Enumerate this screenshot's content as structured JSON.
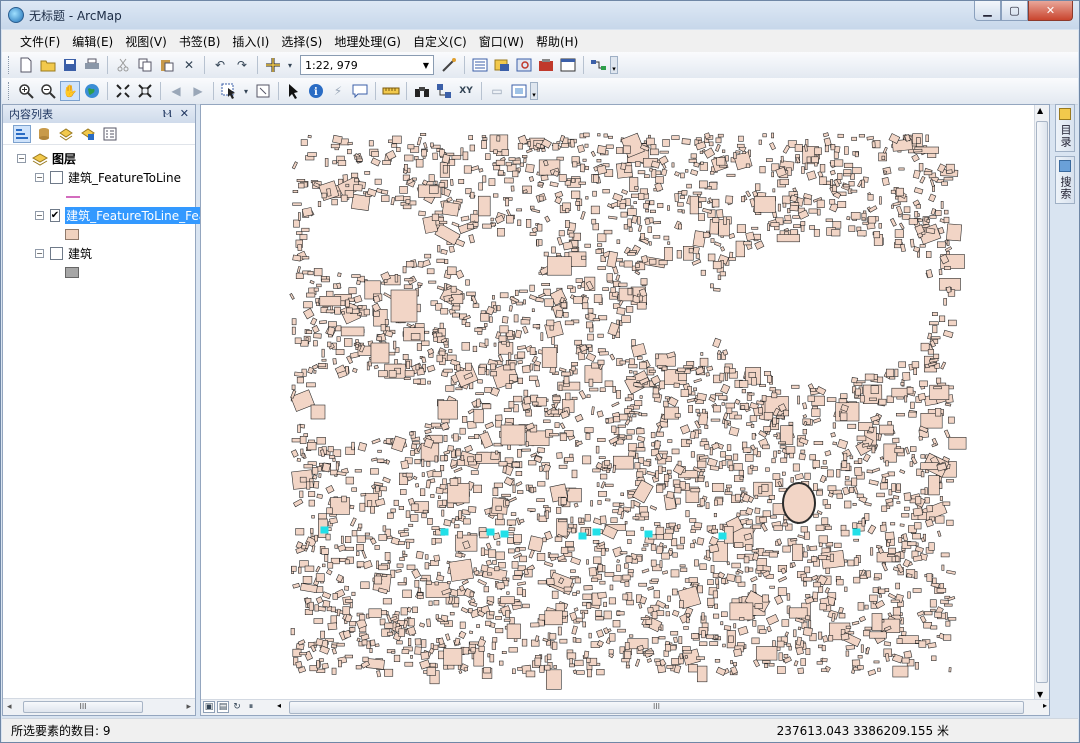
{
  "window": {
    "title": "无标题 - ArcMap",
    "buttons": {
      "minimize": "▁",
      "maximize": "▢",
      "close": "✕"
    }
  },
  "menu": [
    "文件(F)",
    "编辑(E)",
    "视图(V)",
    "书签(B)",
    "插入(I)",
    "选择(S)",
    "地理处理(G)",
    "自定义(C)",
    "窗口(W)",
    "帮助(H)"
  ],
  "toolbar": {
    "scale": "1:22, 979"
  },
  "toc": {
    "title": "内容列表",
    "pin": "Ⲙ",
    "close": "✕",
    "root_label": "图层",
    "layers": [
      {
        "label": "建筑_FeatureToLine",
        "checked": false,
        "swatch_color": "#c43aa8",
        "swatch_type": "line"
      },
      {
        "label": "建筑_FeatureToLine_Fea",
        "checked": true,
        "selected": true,
        "swatch_color": "#f0d2bf",
        "swatch_type": "fill"
      },
      {
        "label": "建筑",
        "checked": false,
        "swatch_color": "#a6a6a6",
        "swatch_type": "fill"
      }
    ],
    "scroll_grip": "III"
  },
  "map": {
    "building_fill": "#f2d5c6",
    "building_stroke": "#2c2c2c",
    "highlight_color": "#22e0e8"
  },
  "side_tabs": [
    "目录",
    "搜索"
  ],
  "hscroll_grip": "III",
  "status": {
    "selected_count": "所选要素的数目: 9",
    "coordinates": "237613.043  3386209.155 米"
  }
}
